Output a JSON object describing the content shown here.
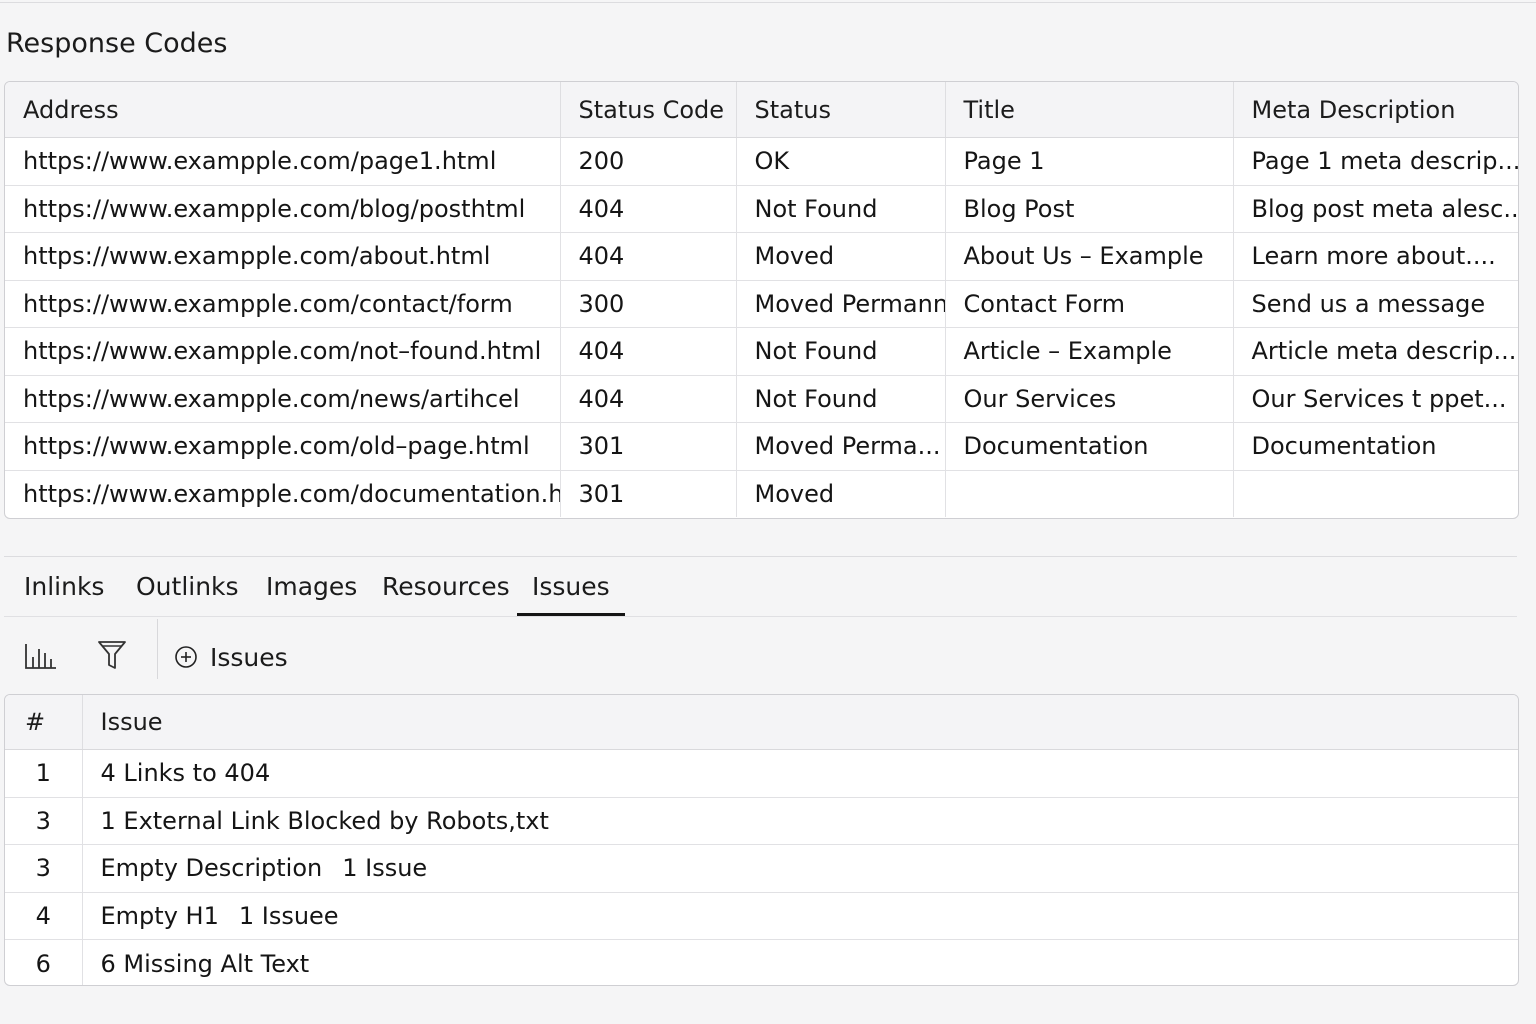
{
  "response_codes": {
    "title": "Response Codes",
    "columns": [
      "Address",
      "Status Code",
      "Status",
      "Title",
      "Meta Description"
    ],
    "rows": [
      [
        "https://www.exampple.com/page1.html",
        "200",
        "OK",
        "Page 1",
        "Page 1 meta descrip..."
      ],
      [
        "https://www.exampple.com/blog/posthtml",
        "404",
        "Not Found",
        "Blog Post",
        "Blog post meta alesc..."
      ],
      [
        "https://www.exampple.com/about.html",
        "404",
        "Moved",
        "About Us – Example",
        "Learn more about...."
      ],
      [
        "https://www.exampple.com/contact/form",
        "300",
        "Moved Permannt",
        "Contact Form",
        "Send us a message"
      ],
      [
        "https://www.exampple.com/not–found.html",
        "404",
        "Not Found",
        "Article – Example",
        "Article meta descrip..."
      ],
      [
        "https://www.exampple.com/news/artihcel",
        "404",
        "Not Found",
        "Our Services",
        "Our Services t ppet..."
      ],
      [
        "https://www.exampple.com/old–page.html",
        "301",
        "Moved Perma...",
        "Documentation",
        "Documentation"
      ],
      [
        "https://www.exampple.com/documentation.h",
        "301",
        "Moved",
        "",
        ""
      ]
    ]
  },
  "tabs": {
    "items": [
      {
        "label": "Inlinks",
        "active": false
      },
      {
        "label": "Outlinks",
        "active": false
      },
      {
        "label": "Images",
        "active": false
      },
      {
        "label": "Resources",
        "active": false
      },
      {
        "label": "Issues",
        "active": true
      }
    ]
  },
  "toolbar": {
    "chart_icon": "bar-chart-icon",
    "filter_icon": "filter-icon",
    "add_icon": "plus-circle-icon",
    "issues_label": "Issues"
  },
  "issues": {
    "columns": [
      "#",
      "Issue"
    ],
    "rows": [
      {
        "num": "1",
        "text": "4 Links to 404",
        "extra": ""
      },
      {
        "num": "3",
        "text": "1 External Link Blocked by Robots,txt",
        "extra": ""
      },
      {
        "num": "3",
        "text": "Empty Description",
        "extra": "1 Issue"
      },
      {
        "num": "4",
        "text": "Empty H1",
        "extra": "1 Issuee"
      },
      {
        "num": "6",
        "text": "6 Missing Alt Text",
        "extra": ""
      }
    ]
  }
}
